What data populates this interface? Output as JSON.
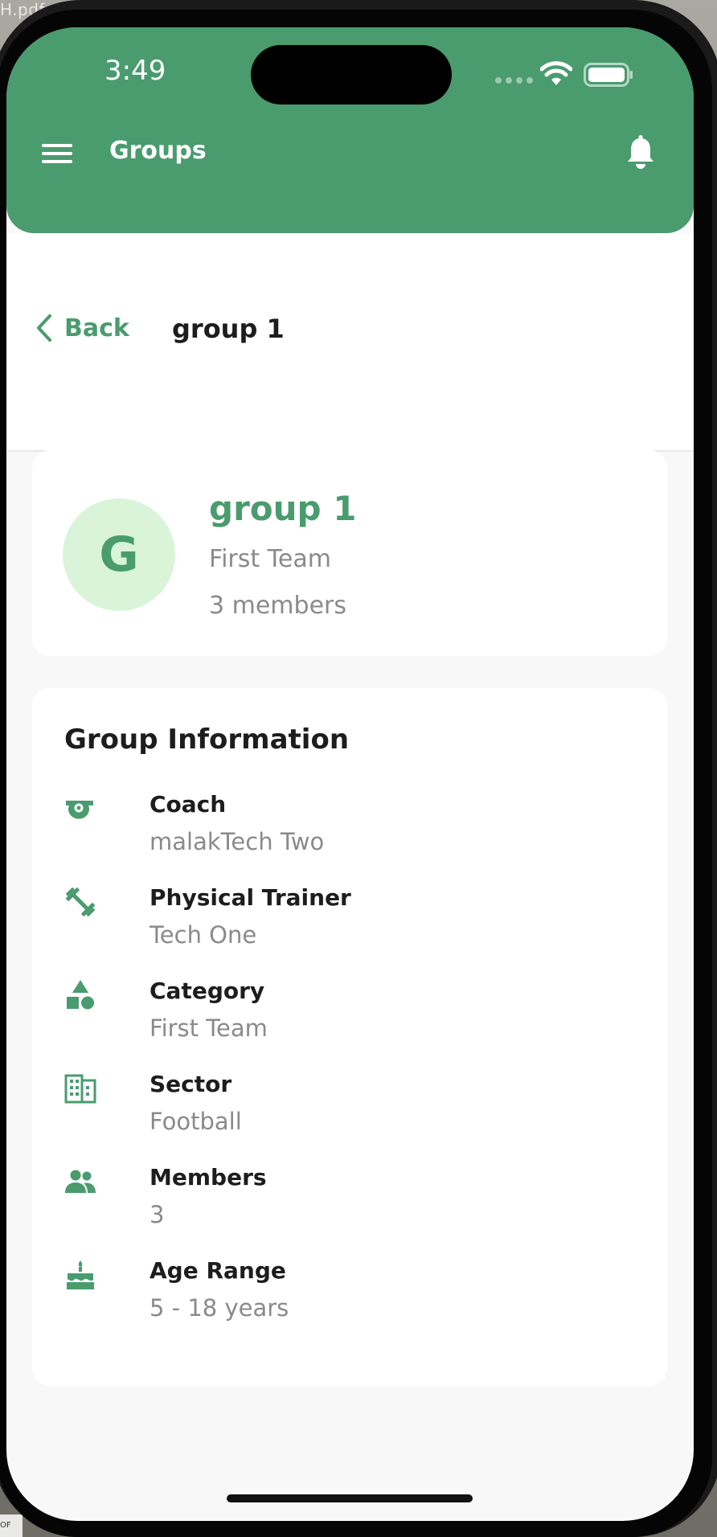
{
  "overlay": {
    "file_label": "H.pdf",
    "file_label_bottom": "OF"
  },
  "status_bar": {
    "time": "3:49"
  },
  "header": {
    "title": "Groups"
  },
  "subnav": {
    "back_label": "Back",
    "title": "group 1"
  },
  "summary": {
    "avatar_letter": "G",
    "name": "group 1",
    "category": "First Team",
    "members": "3 members"
  },
  "info": {
    "title": "Group Information",
    "rows": [
      {
        "icon": "whistle-icon",
        "label": "Coach",
        "value": "malakTech Two"
      },
      {
        "icon": "dumbbell-icon",
        "label": "Physical Trainer",
        "value": "Tech One"
      },
      {
        "icon": "category-shapes-icon",
        "label": "Category",
        "value": "First Team"
      },
      {
        "icon": "building-icon",
        "label": "Sector",
        "value": "Football"
      },
      {
        "icon": "people-icon",
        "label": "Members",
        "value": "3"
      },
      {
        "icon": "cake-icon",
        "label": "Age Range",
        "value": "5 - 18 years"
      }
    ]
  },
  "colors": {
    "accent": "#4a9b6e",
    "avatar_bg": "#d9f4d9",
    "muted_text": "#8a8a8a",
    "page_bg": "#f8f8f8"
  }
}
